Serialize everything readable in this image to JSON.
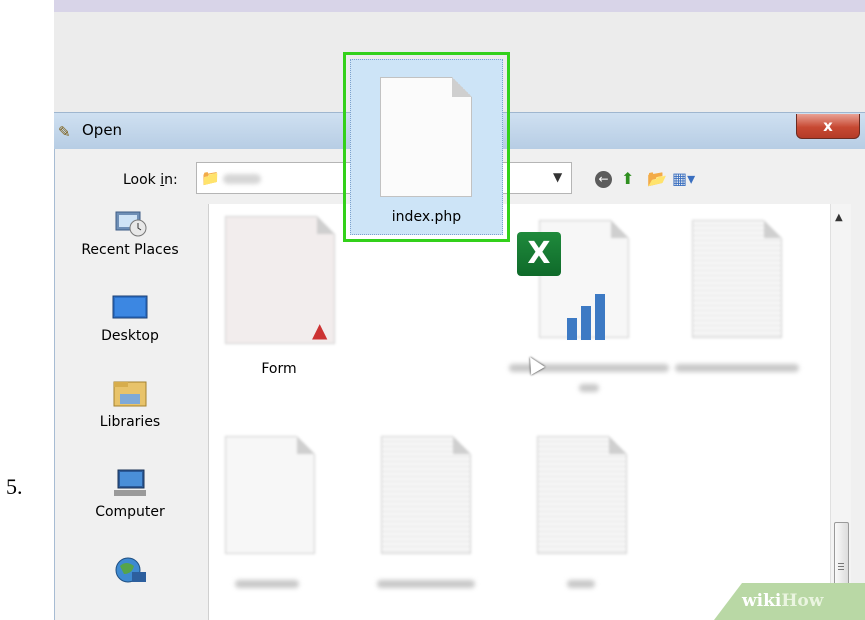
{
  "step_number": "5.",
  "dialog": {
    "title": "Open",
    "close_label": "x",
    "look_in_label": "Look in:",
    "look_in_value": ""
  },
  "places": [
    {
      "label": "Recent Places",
      "icon": "recent-places-icon"
    },
    {
      "label": "Desktop",
      "icon": "desktop-icon"
    },
    {
      "label": "Libraries",
      "icon": "libraries-icon"
    },
    {
      "label": "Computer",
      "icon": "computer-icon"
    },
    {
      "label": "",
      "icon": "network-icon"
    }
  ],
  "files": [
    {
      "name": "Form",
      "icon": "pdf-file-icon"
    },
    {
      "name": "index.php",
      "icon": "blank-file-icon",
      "selected": true
    },
    {
      "name": "",
      "icon": "excel-file-icon"
    },
    {
      "name": "",
      "icon": "text-file-icon"
    },
    {
      "name": "",
      "icon": "blank-file-icon"
    },
    {
      "name": "",
      "icon": "text-file-icon"
    },
    {
      "name": "",
      "icon": "text-file-icon"
    }
  ],
  "highlight_color": "#33d11a",
  "watermark": {
    "wiki": "wiki",
    "how": "How"
  }
}
